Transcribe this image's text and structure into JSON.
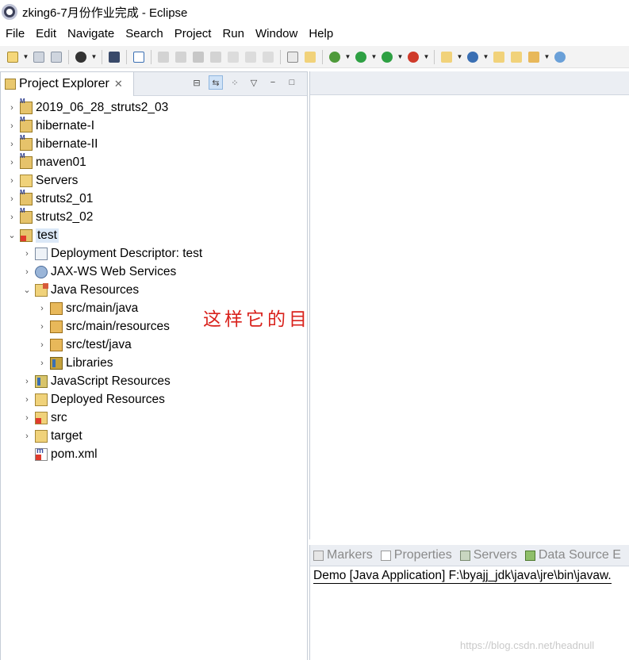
{
  "window": {
    "title": "zking6-7月份作业完成 - Eclipse"
  },
  "menubar": {
    "items": [
      "File",
      "Edit",
      "Navigate",
      "Search",
      "Project",
      "Run",
      "Window",
      "Help"
    ]
  },
  "explorer": {
    "tab_label": "Project Explorer",
    "tab_close": "✕",
    "tree": [
      {
        "label": "2019_06_28_struts2_03",
        "icon": "maven-project-icon",
        "expanded": false,
        "depth": 0
      },
      {
        "label": "hibernate-I",
        "icon": "maven-project-icon",
        "expanded": false,
        "depth": 0
      },
      {
        "label": "hibernate-II",
        "icon": "maven-project-icon",
        "expanded": false,
        "depth": 0
      },
      {
        "label": "maven01",
        "icon": "maven-project-icon",
        "expanded": false,
        "depth": 0
      },
      {
        "label": "Servers",
        "icon": "folder-icon",
        "expanded": false,
        "depth": 0
      },
      {
        "label": "struts2_01",
        "icon": "maven-project-icon",
        "expanded": false,
        "depth": 0
      },
      {
        "label": "struts2_02",
        "icon": "maven-project-icon",
        "expanded": false,
        "depth": 0
      },
      {
        "label": "test",
        "icon": "maven-project-error-icon",
        "expanded": true,
        "depth": 0,
        "selected": true
      },
      {
        "label": "Deployment Descriptor: test",
        "icon": "deployment-descriptor-icon",
        "expanded": false,
        "depth": 1
      },
      {
        "label": "JAX-WS Web Services",
        "icon": "web-services-icon",
        "expanded": false,
        "depth": 1
      },
      {
        "label": "Java Resources",
        "icon": "java-resources-icon",
        "expanded": true,
        "depth": 1
      },
      {
        "label": "src/main/java",
        "icon": "source-folder-icon",
        "expanded": false,
        "depth": 2
      },
      {
        "label": "src/main/resources",
        "icon": "source-folder-icon",
        "expanded": false,
        "depth": 2
      },
      {
        "label": "src/test/java",
        "icon": "source-folder-icon",
        "expanded": false,
        "depth": 2
      },
      {
        "label": "Libraries",
        "icon": "libraries-icon",
        "expanded": false,
        "depth": 2
      },
      {
        "label": "JavaScript Resources",
        "icon": "javascript-resources-icon",
        "expanded": false,
        "depth": 1
      },
      {
        "label": "Deployed Resources",
        "icon": "deployed-resources-icon",
        "expanded": false,
        "depth": 1
      },
      {
        "label": "src",
        "icon": "folder-error-icon",
        "expanded": false,
        "depth": 1
      },
      {
        "label": "target",
        "icon": "folder-icon",
        "expanded": false,
        "depth": 1
      },
      {
        "label": "pom.xml",
        "icon": "pom-xml-icon",
        "expanded": null,
        "depth": 1
      }
    ]
  },
  "annotation": {
    "text": "这样它的目录就都出来了",
    "color": "#d9221c"
  },
  "bottom": {
    "tabs": [
      "Markers",
      "Properties",
      "Servers",
      "Data Source E"
    ],
    "console_line": "Demo [Java Application] F:\\byajj_jdk\\java\\jre\\bin\\javaw."
  },
  "watermark": "https://blog.csdn.net/headnull"
}
